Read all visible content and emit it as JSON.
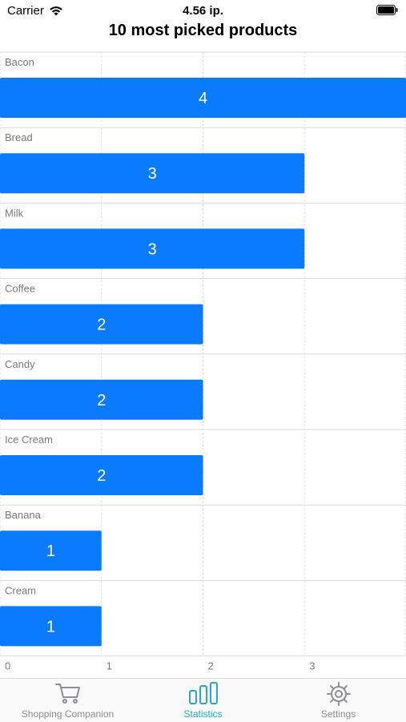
{
  "status_bar": {
    "carrier": "Carrier",
    "time": "4.56 ip.",
    "wifi_icon": "wifi-icon",
    "battery_icon": "battery-icon"
  },
  "navigation": {
    "title": "10 most picked products"
  },
  "chart_data": {
    "type": "bar",
    "orientation": "horizontal",
    "title": "10 most picked products",
    "categories": [
      "Bacon",
      "Bread",
      "Milk",
      "Coffee",
      "Candy",
      "Ice Cream",
      "Banana",
      "Cream"
    ],
    "values": [
      4,
      3,
      3,
      2,
      2,
      2,
      1,
      1
    ],
    "x_ticks": [
      "0",
      "1",
      "2",
      "3"
    ],
    "xlim": [
      0,
      4
    ],
    "grid": true,
    "bar_color": "#0a7aff",
    "value_label_color": "#ffffff"
  },
  "tab_bar": {
    "items": [
      {
        "label": "Shopping Companion",
        "icon": "cart-icon",
        "active": false
      },
      {
        "label": "Statistics",
        "icon": "bar-chart-icon",
        "active": true
      },
      {
        "label": "Settings",
        "icon": "gear-icon",
        "active": false
      }
    ],
    "active_color": "#2aa8c4",
    "inactive_color": "#8e8e93"
  }
}
